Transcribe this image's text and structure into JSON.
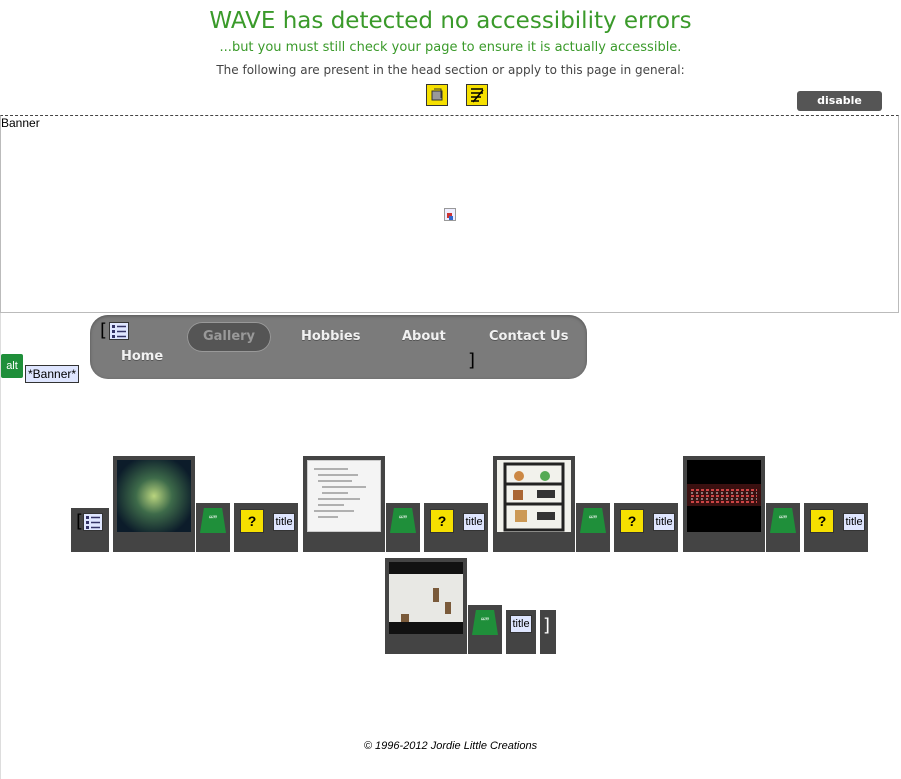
{
  "wave": {
    "title": "WAVE has detected no accessibility errors",
    "subtitle": "...but you must still check your page to ensure it is actually accessible.",
    "head_note": "The following are present in the head section or apply to this page in general:",
    "disable_styles_label": "disable styles",
    "head_icons": [
      "language-icon",
      "page-title-icon"
    ]
  },
  "banner": {
    "label": "Banner",
    "alt_tag_label": "alt",
    "alt_text": "*Banner*"
  },
  "nav": {
    "items": [
      {
        "label": "Home"
      },
      {
        "label": "Gallery",
        "active": true
      },
      {
        "label": "Hobbies"
      },
      {
        "label": "About"
      },
      {
        "label": "Contact Us"
      }
    ],
    "open_bracket": "[",
    "close_bracket": "]"
  },
  "gallery": {
    "open_bracket": "[",
    "close_bracket": "]",
    "tag_labels": {
      "quote": "“”",
      "help": "?",
      "title": "title"
    }
  },
  "footer": {
    "text": "© 1996-2012 Jordie Little Creations"
  },
  "colors": {
    "wave_green": "#3a9a2a",
    "nav_bg": "#7b7b7b",
    "tile_bg": "#444444",
    "icon_yellow": "#f6e000",
    "icon_blue": "#dfe6ff",
    "icon_green": "#1f8f3a"
  }
}
